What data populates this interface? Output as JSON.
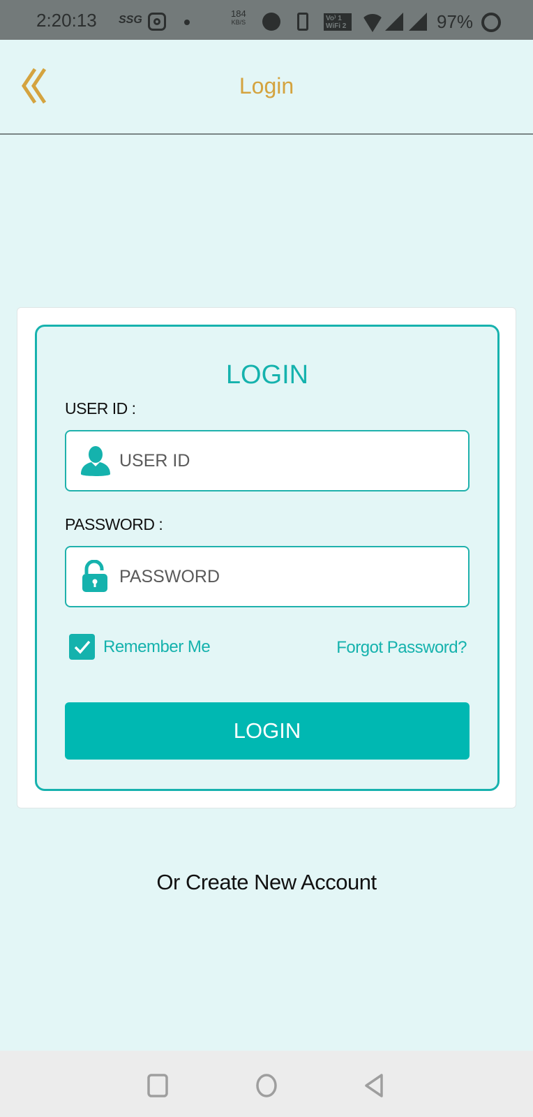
{
  "status_bar": {
    "time": "2:20:13",
    "carrier_tag": "SSG",
    "network_speed_value": "184",
    "network_speed_unit": "KB/S",
    "volte_line1": "Vo⁾ 1",
    "volte_line2": "WiFi 2",
    "battery": "97%"
  },
  "app_bar": {
    "title": "Login",
    "back_icon": "double-chevron-left",
    "accent_color": "#d4a33f"
  },
  "login_form": {
    "heading": "LOGIN",
    "user_id": {
      "label": "USER ID :",
      "placeholder": "USER ID",
      "value": "",
      "icon": "user-icon"
    },
    "password": {
      "label": "PASSWORD :",
      "placeholder": "PASSWORD",
      "value": "",
      "icon": "unlock-icon"
    },
    "remember_me": {
      "label": "Remember Me",
      "checked": true
    },
    "forgot_password": "Forgot Password?",
    "submit_label": "LOGIN",
    "accent_color": "#15b2ad"
  },
  "create_account": "Or Create New Account",
  "nav_bar": {
    "buttons": [
      "recents",
      "home",
      "back"
    ]
  }
}
